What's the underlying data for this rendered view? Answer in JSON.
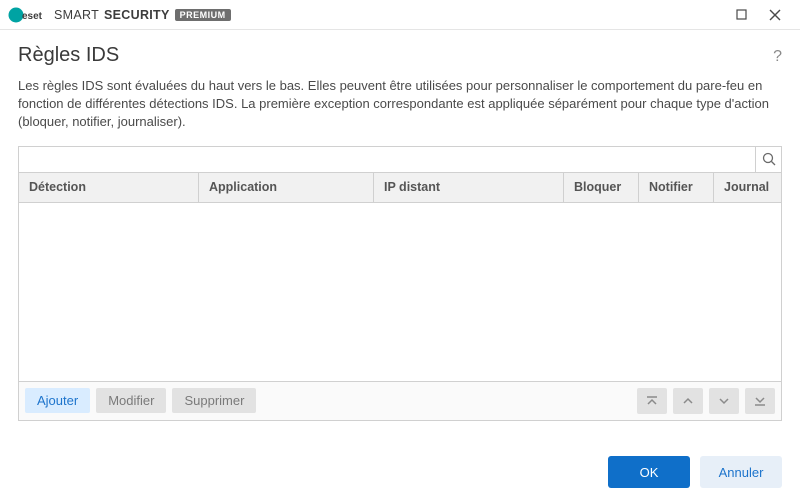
{
  "brand": {
    "name_light": "SMART",
    "name_bold": "SECURITY",
    "badge": "PREMIUM"
  },
  "window": {
    "title": "Règles IDS"
  },
  "description": "Les règles IDS sont évaluées du haut vers le bas. Elles peuvent être utilisées pour personnaliser le comportement du pare-feu en fonction de différentes détections IDS. La première exception correspondante est appliquée séparément pour chaque type d'action (bloquer, notifier, journaliser).",
  "search": {
    "placeholder": ""
  },
  "columns": {
    "detection": "Détection",
    "application": "Application",
    "remote_ip": "IP distant",
    "block": "Bloquer",
    "notify": "Notifier",
    "log": "Journal"
  },
  "rows": [],
  "toolbar": {
    "add": "Ajouter",
    "edit": "Modifier",
    "delete": "Supprimer"
  },
  "footer": {
    "ok": "OK",
    "cancel": "Annuler"
  }
}
